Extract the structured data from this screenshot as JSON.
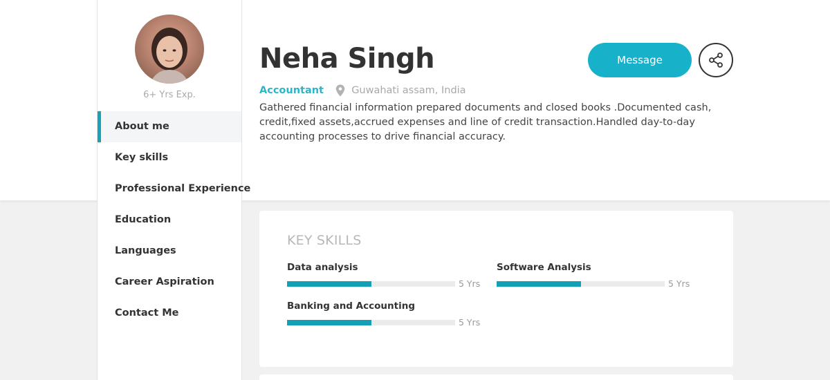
{
  "profile": {
    "experience": "6+ Yrs Exp.",
    "name": "Neha Singh",
    "role": "Accountant",
    "location": "Guwahati assam, India",
    "about": "Gathered financial information prepared documents and closed books .Documented cash, credit,fixed assets,accrued expenses and line of credit transaction.Handled day-to-day accounting processes to drive financial accuracy."
  },
  "actions": {
    "message_label": "Message",
    "share_icon": "share-icon"
  },
  "sidebar": {
    "items": [
      {
        "label": "About me",
        "active": true
      },
      {
        "label": "Key skills",
        "active": false
      },
      {
        "label": "Professional Experience",
        "active": false
      },
      {
        "label": "Education",
        "active": false
      },
      {
        "label": "Languages",
        "active": false
      },
      {
        "label": "Career Aspiration",
        "active": false
      },
      {
        "label": "Contact Me",
        "active": false
      }
    ]
  },
  "skills": {
    "title": "KEY SKILLS",
    "items": [
      {
        "name": "Data analysis",
        "years": "5 Yrs",
        "level": 0.5
      },
      {
        "name": "Software Analysis",
        "years": "5 Yrs",
        "level": 0.5
      },
      {
        "name": "Banking and Accounting",
        "years": "5 Yrs",
        "level": 0.5
      }
    ]
  },
  "colors": {
    "accent": "#17b1c9",
    "bar_fill": "#14a0b4",
    "role_text": "#2db5c8"
  }
}
